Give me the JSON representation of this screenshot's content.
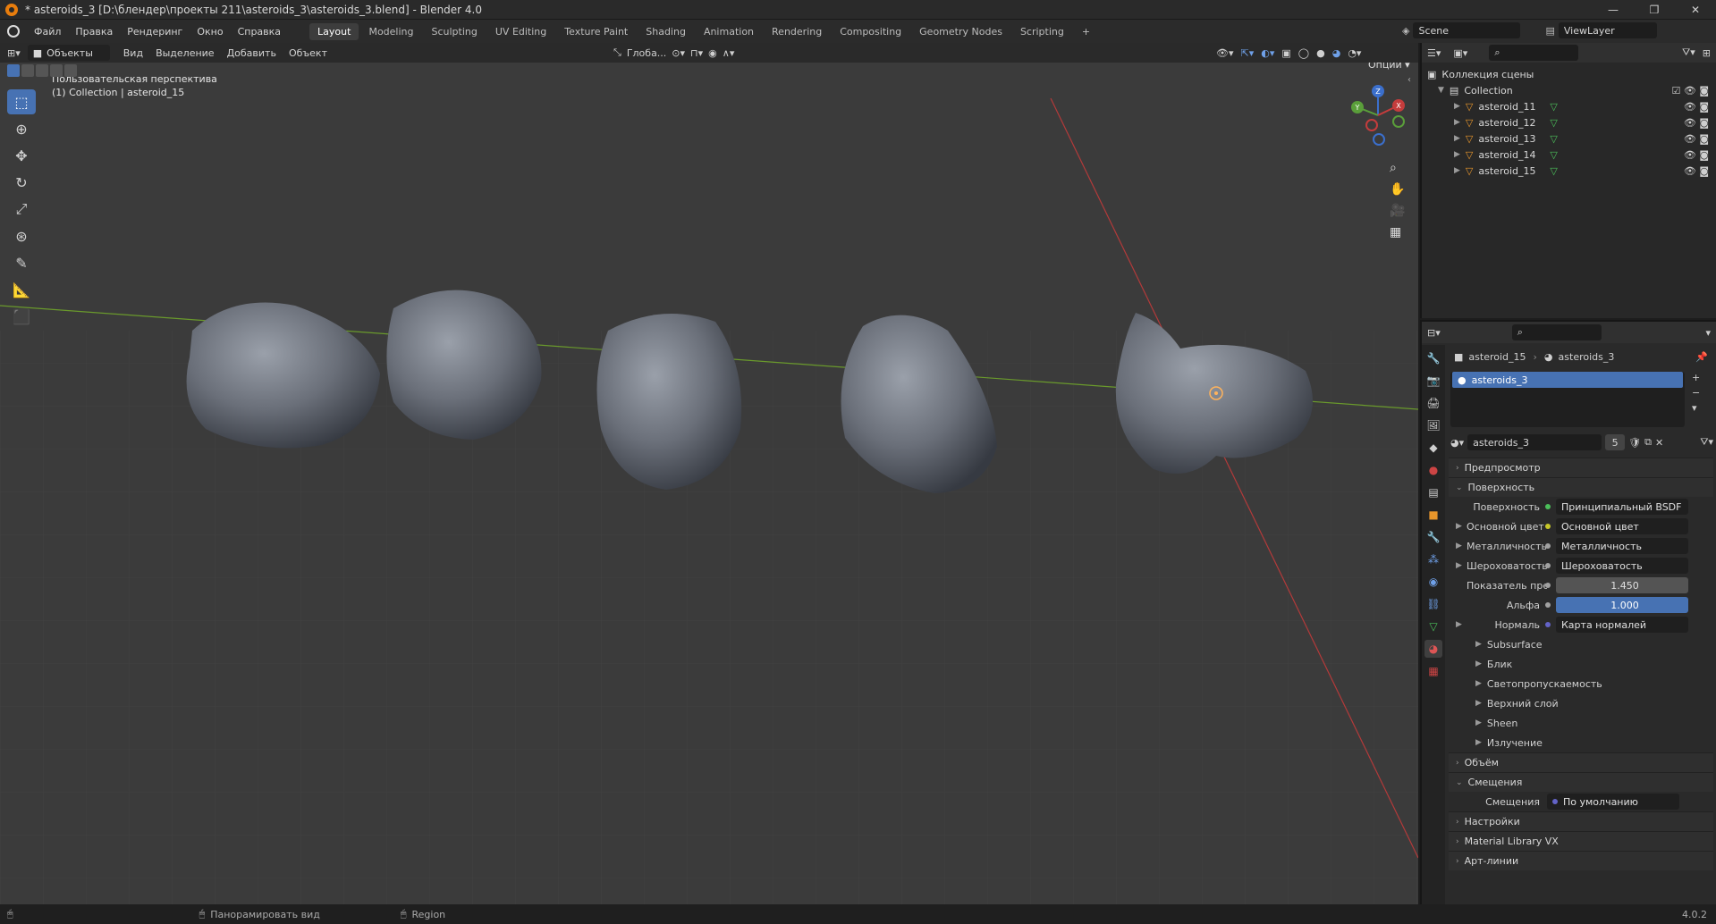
{
  "window": {
    "title": "* asteroids_3 [D:\\блендер\\проекты 211\\asteroids_3\\asteroids_3.blend] - Blender 4.0",
    "controls": [
      "—",
      "❐",
      "✕"
    ]
  },
  "menu": {
    "items": [
      "Файл",
      "Правка",
      "Рендеринг",
      "Окно",
      "Справка"
    ]
  },
  "workspaces": {
    "tabs": [
      "Layout",
      "Modeling",
      "Sculpting",
      "UV Editing",
      "Texture Paint",
      "Shading",
      "Animation",
      "Rendering",
      "Compositing",
      "Geometry Nodes",
      "Scripting"
    ],
    "add": "+"
  },
  "scene": {
    "name": "Scene",
    "view_layer": "ViewLayer"
  },
  "viewport_header": {
    "mode": "Объекты",
    "menus": [
      "Вид",
      "Выделение",
      "Добавить",
      "Объект"
    ],
    "orientation": "Глоба...",
    "options": "Опции"
  },
  "viewport": {
    "view_name": "Пользовательская перспектива",
    "object_info": "(1) Collection | asteroid_15"
  },
  "gizmo": {
    "x": "X",
    "y": "Y",
    "z": "Z"
  },
  "outliner": {
    "scene_collection": "Коллекция сцены",
    "collection": "Collection",
    "objects": [
      "asteroid_11",
      "asteroid_12",
      "asteroid_13",
      "asteroid_14",
      "asteroid_15"
    ]
  },
  "properties": {
    "breadcrumb_object": "asteroid_15",
    "breadcrumb_material": "asteroids_3",
    "slot_material": "asteroids_3",
    "material_name": "asteroids_3",
    "users": "5",
    "sections": {
      "preview": "Предпросмотр",
      "surface": "Поверхность",
      "volume": "Объём",
      "displacement": "Смещения",
      "settings": "Настройки",
      "matlib": "Material Library VX",
      "lineart": "Арт-линии"
    },
    "surface_rows": [
      {
        "label": "Поверхность",
        "value": "Принципиальный BSDF",
        "dot": "#4bbf5a"
      },
      {
        "label": "Основной цвет",
        "value": "Основной цвет",
        "dot": "#c7c729"
      },
      {
        "label": "Металличность",
        "value": "Металличность",
        "dot": "#a1a1a1"
      },
      {
        "label": "Шероховатость",
        "value": "Шероховатость",
        "dot": "#a1a1a1"
      },
      {
        "label": "Показатель прело...",
        "value": "1.450",
        "dot": "#a1a1a1"
      },
      {
        "label": "Альфа",
        "value": "1.000",
        "dot": "#a1a1a1"
      },
      {
        "label": "Нормаль",
        "value": "Карта нормалей",
        "dot": "#6363c7"
      }
    ],
    "subpanels": [
      "Subsurface",
      "Блик",
      "Светопропускаемость",
      "Верхний слой",
      "Sheen",
      "Излучение"
    ],
    "displacement_row": {
      "label": "Смещения",
      "value": "По умолчанию",
      "dot": "#6363c7"
    }
  },
  "statusbar": {
    "pan": "Панорамировать вид",
    "region": "Region",
    "version": "4.0.2"
  }
}
